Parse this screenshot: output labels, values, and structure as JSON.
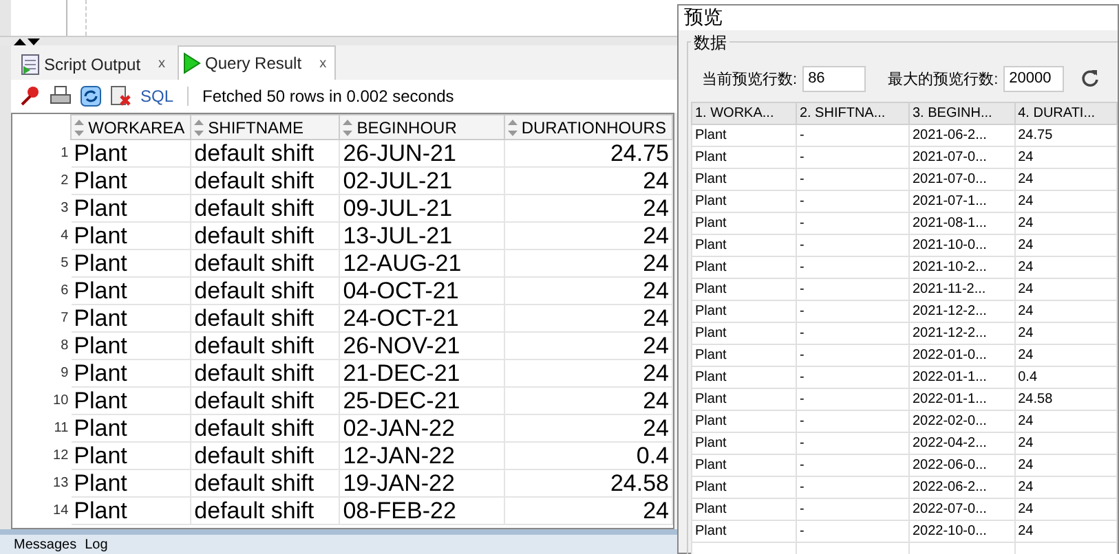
{
  "result_panel": {
    "tabs": [
      {
        "label": "Script Output",
        "selected": false,
        "kind": "script",
        "close": "x"
      },
      {
        "label": "Query Result",
        "selected": true,
        "kind": "query",
        "close": "x"
      }
    ],
    "toolbar": {
      "sql_link": "SQL",
      "status": "Fetched 50 rows in 0.002 seconds"
    },
    "table": {
      "columns": [
        "WORKAREA",
        "SHIFTNAME",
        "BEGINHOUR",
        "DURATIONHOURS"
      ],
      "rows": [
        {
          "num": "1",
          "cells": [
            "Plant",
            "default shift",
            "26-JUN-21",
            "24.75"
          ]
        },
        {
          "num": "2",
          "cells": [
            "Plant",
            "default shift",
            "02-JUL-21",
            "24"
          ]
        },
        {
          "num": "3",
          "cells": [
            "Plant",
            "default shift",
            "09-JUL-21",
            "24"
          ]
        },
        {
          "num": "4",
          "cells": [
            "Plant",
            "default shift",
            "13-JUL-21",
            "24"
          ]
        },
        {
          "num": "5",
          "cells": [
            "Plant",
            "default shift",
            "12-AUG-21",
            "24"
          ]
        },
        {
          "num": "6",
          "cells": [
            "Plant",
            "default shift",
            "04-OCT-21",
            "24"
          ]
        },
        {
          "num": "7",
          "cells": [
            "Plant",
            "default shift",
            "24-OCT-21",
            "24"
          ]
        },
        {
          "num": "8",
          "cells": [
            "Plant",
            "default shift",
            "26-NOV-21",
            "24"
          ]
        },
        {
          "num": "9",
          "cells": [
            "Plant",
            "default shift",
            "21-DEC-21",
            "24"
          ]
        },
        {
          "num": "10",
          "cells": [
            "Plant",
            "default shift",
            "25-DEC-21",
            "24"
          ]
        },
        {
          "num": "11",
          "cells": [
            "Plant",
            "default shift",
            "02-JAN-22",
            "24"
          ]
        },
        {
          "num": "12",
          "cells": [
            "Plant",
            "default shift",
            "12-JAN-22",
            "0.4"
          ]
        },
        {
          "num": "13",
          "cells": [
            "Plant",
            "default shift",
            "19-JAN-22",
            "24.58"
          ]
        },
        {
          "num": "14",
          "cells": [
            "Plant",
            "default shift",
            "08-FEB-22",
            "24"
          ]
        }
      ]
    },
    "bottom_tabs": [
      "Messages",
      "Log"
    ]
  },
  "preview_dialog": {
    "title": "预览",
    "group": "数据",
    "current_rows_label": "当前预览行数:",
    "current_rows": "86",
    "max_rows_label": "最大的预览行数:",
    "max_rows": "20000",
    "table": {
      "columns": [
        "1. WORKA...",
        "2. SHIFTNA...",
        "3. BEGINH...",
        "4. DURATI..."
      ],
      "rows": [
        [
          "Plant",
          "-",
          "2021-06-2...",
          "24.75"
        ],
        [
          "Plant",
          "-",
          "2021-07-0...",
          "24"
        ],
        [
          "Plant",
          "-",
          "2021-07-0...",
          "24"
        ],
        [
          "Plant",
          "-",
          "2021-07-1...",
          "24"
        ],
        [
          "Plant",
          "-",
          "2021-08-1...",
          "24"
        ],
        [
          "Plant",
          "-",
          "2021-10-0...",
          "24"
        ],
        [
          "Plant",
          "-",
          "2021-10-2...",
          "24"
        ],
        [
          "Plant",
          "-",
          "2021-11-2...",
          "24"
        ],
        [
          "Plant",
          "-",
          "2021-12-2...",
          "24"
        ],
        [
          "Plant",
          "-",
          "2021-12-2...",
          "24"
        ],
        [
          "Plant",
          "-",
          "2022-01-0...",
          "24"
        ],
        [
          "Plant",
          "-",
          "2022-01-1...",
          "0.4"
        ],
        [
          "Plant",
          "-",
          "2022-01-1...",
          "24.58"
        ],
        [
          "Plant",
          "-",
          "2022-02-0...",
          "24"
        ],
        [
          "Plant",
          "-",
          "2022-04-2...",
          "24"
        ],
        [
          "Plant",
          "-",
          "2022-06-0...",
          "24"
        ],
        [
          "Plant",
          "-",
          "2022-06-2...",
          "24"
        ],
        [
          "Plant",
          "-",
          "2022-07-0...",
          "24"
        ],
        [
          "Plant",
          "-",
          "2022-10-0...",
          "24"
        ]
      ]
    }
  }
}
